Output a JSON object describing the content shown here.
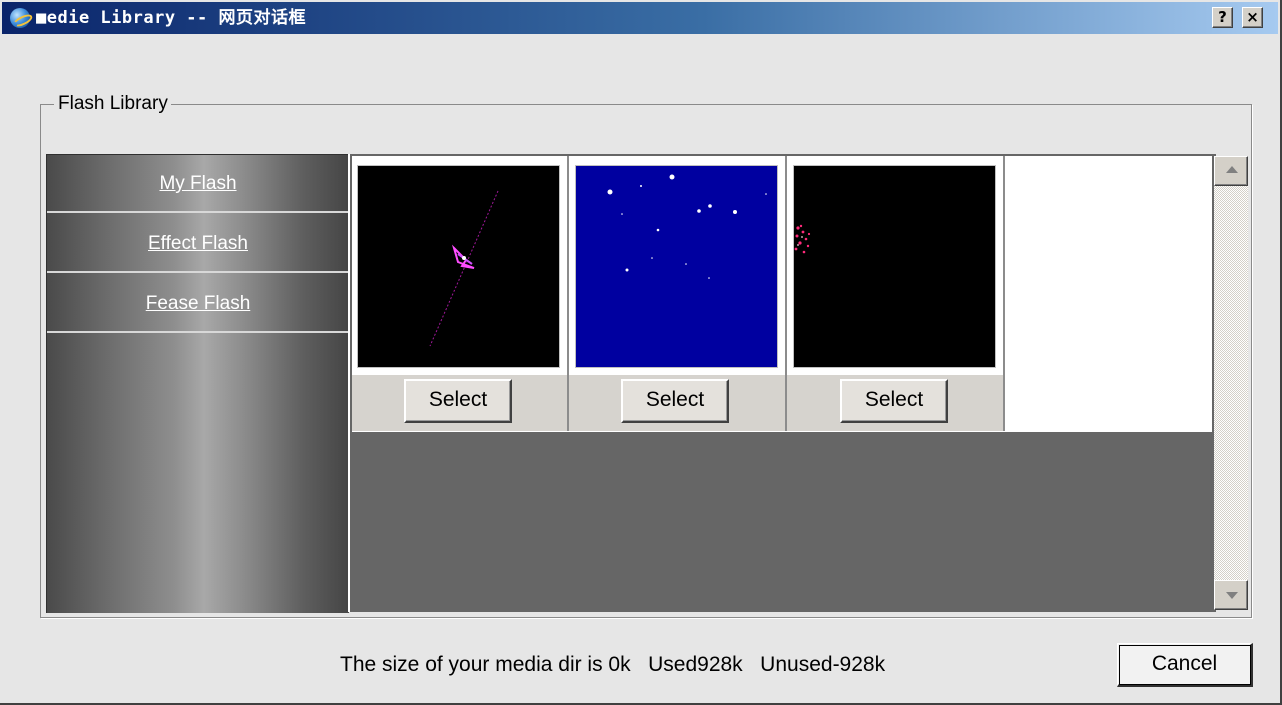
{
  "window": {
    "title": "■edie Library -- 网页对话框",
    "help_label": "?",
    "close_label": "×"
  },
  "group": {
    "legend": "Flash Library"
  },
  "sidebar": {
    "items": [
      {
        "label": "My Flash"
      },
      {
        "label": "Effect Flash"
      },
      {
        "label": "Fease Flash"
      }
    ]
  },
  "gallery": {
    "items": [
      {
        "thumb_bg": "#000000",
        "select_label": "Select"
      },
      {
        "thumb_bg": "#0000a0",
        "select_label": "Select"
      },
      {
        "thumb_bg": "#000000",
        "select_label": "Select"
      }
    ]
  },
  "footer": {
    "status": "The size of your media dir is 0k   Used928k   Unused-928k",
    "cancel_label": "Cancel"
  }
}
